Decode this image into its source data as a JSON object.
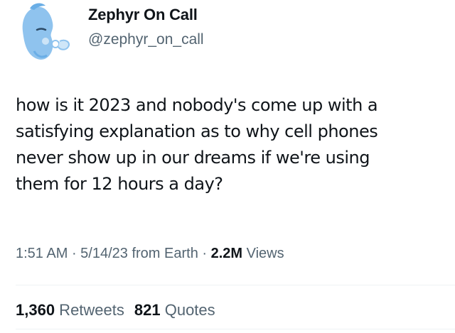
{
  "author": {
    "name": "Zephyr On Call",
    "handle": "@zephyr_on_call",
    "avatar_icon": "zephyr-wind-face-icon"
  },
  "tweet": {
    "lines": [
      "how is it 2023 and nobody's come up with a",
      "satisfying explanation as to why cell phones",
      "never show up in our dreams if we're using",
      "them for 12 hours a day?"
    ]
  },
  "meta": {
    "time": "1:51 AM",
    "sep1": " · ",
    "date": "5/14/23",
    "source": " from Earth",
    "sep2": " · ",
    "views_count": "2.2M",
    "views_label": " Views"
  },
  "stats": {
    "retweets_count": "1,360",
    "retweets_label": " Retweets",
    "quotes_count": "821",
    "quotes_label": " Quotes"
  },
  "colors": {
    "text": "#0f1419",
    "secondary": "#536471",
    "avatar_blue": "#8fc3ee",
    "divider": "#eff3f4"
  }
}
